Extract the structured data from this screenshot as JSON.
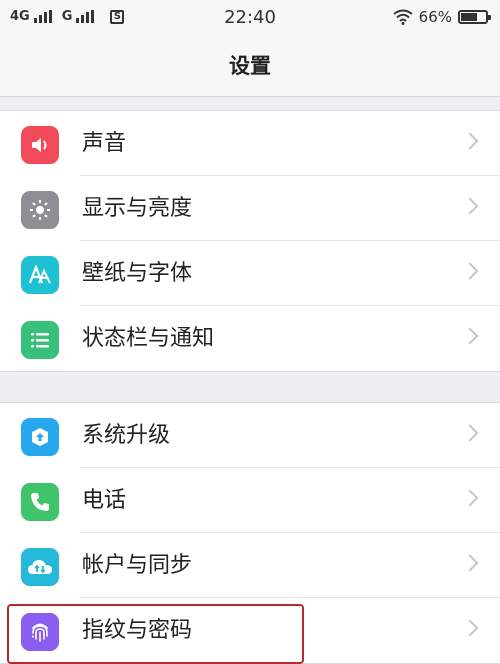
{
  "status_bar": {
    "network1": "4G",
    "network2": "G",
    "sim_badge": "S",
    "time": "22:40",
    "battery": "66%",
    "battery_level": 0.66
  },
  "header": {
    "title": "设置"
  },
  "groups": [
    {
      "items": [
        {
          "label": "声音",
          "icon": "volume-icon",
          "color": "#f24a5b"
        },
        {
          "label": "显示与亮度",
          "icon": "brightness-icon",
          "color": "#8e8e93"
        },
        {
          "label": "壁纸与字体",
          "icon": "font-icon",
          "color": "#1ec0d3"
        },
        {
          "label": "状态栏与通知",
          "icon": "list-icon",
          "color": "#36c07a"
        }
      ]
    },
    {
      "items": [
        {
          "label": "系统升级",
          "icon": "upgrade-icon",
          "color": "#27a7ec"
        },
        {
          "label": "电话",
          "icon": "phone-icon",
          "color": "#3fc46c"
        },
        {
          "label": "帐户与同步",
          "icon": "cloud-sync-icon",
          "color": "#26b8d9"
        },
        {
          "label": "指纹与密码",
          "icon": "fingerprint-icon",
          "color": "#8a5ef0"
        }
      ]
    }
  ]
}
